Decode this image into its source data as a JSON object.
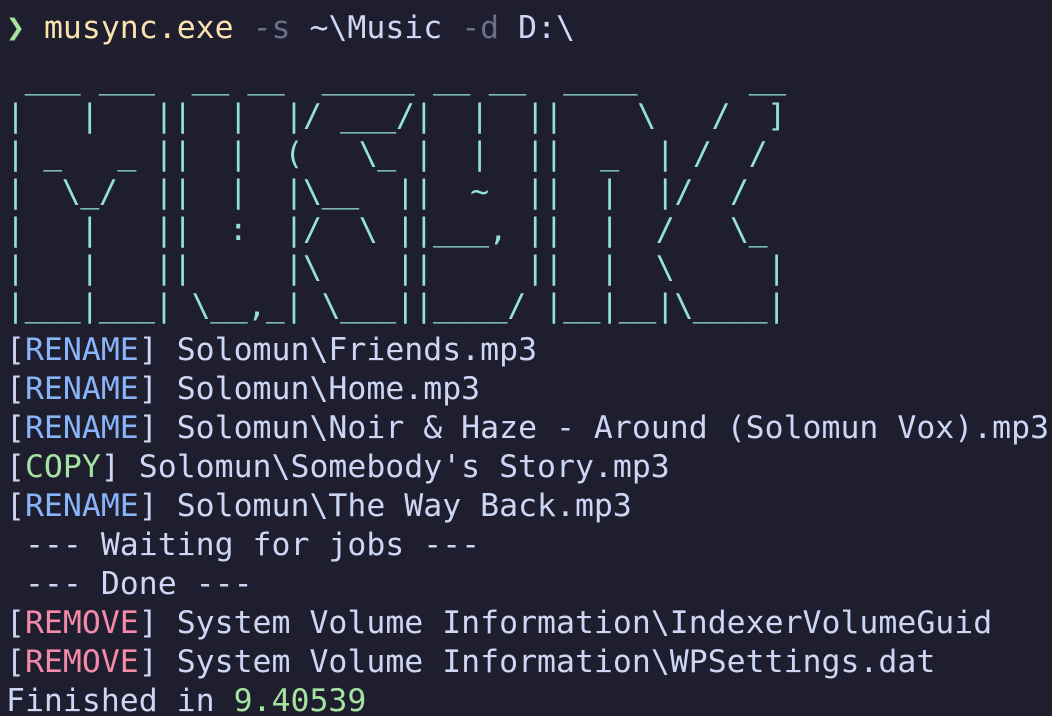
{
  "prompt": {
    "symbol": "❯",
    "command": "musync.exe",
    "flag_source": "-s",
    "source_path": "~\\Music",
    "flag_dest": "-d",
    "dest_path": "D:\\"
  },
  "logo_lines": [
    " ___ ___  __ __  _____ __ __  ____      __ ",
    "|   |   ||  |  |/ ___/|  |  ||    \\   /  ]",
    "| _   _ ||  |  (   \\_ |  |  ||  _  | /  / ",
    "|  \\_/  ||  |  |\\__  ||  ~  ||  |  |/  /  ",
    "|   |   ||  :  |/  \\ ||___, ||  |  /   \\_ ",
    "|   |   ||     |\\    ||     ||  |  \\     |",
    "|___|___| \\__,_| \\___||____/ |__|__|\\____|"
  ],
  "log": [
    {
      "tag": "RENAME",
      "path": "Solomun\\Friends.mp3"
    },
    {
      "tag": "RENAME",
      "path": "Solomun\\Home.mp3"
    },
    {
      "tag": "RENAME",
      "path": "Solomun\\Noir & Haze - Around (Solomun Vox).mp3"
    },
    {
      "tag": "COPY",
      "path": "Solomun\\Somebody's Story.mp3"
    },
    {
      "tag": "RENAME",
      "path": "Solomun\\The Way Back.mp3"
    }
  ],
  "status": {
    "waiting": " --- Waiting for jobs ---",
    "done": " --- Done ---"
  },
  "removals": [
    {
      "tag": "REMOVE",
      "path": "System Volume Information\\IndexerVolumeGuid"
    },
    {
      "tag": "REMOVE",
      "path": "System Volume Information\\WPSettings.dat"
    }
  ],
  "finished": {
    "label": "Finished in",
    "value": "9.40539"
  },
  "colors": {
    "background": "#1e1e2e",
    "rename": "#89b4fa",
    "copy": "#a6e3a1",
    "remove": "#f38ba8",
    "logo": "#94e2d5"
  }
}
